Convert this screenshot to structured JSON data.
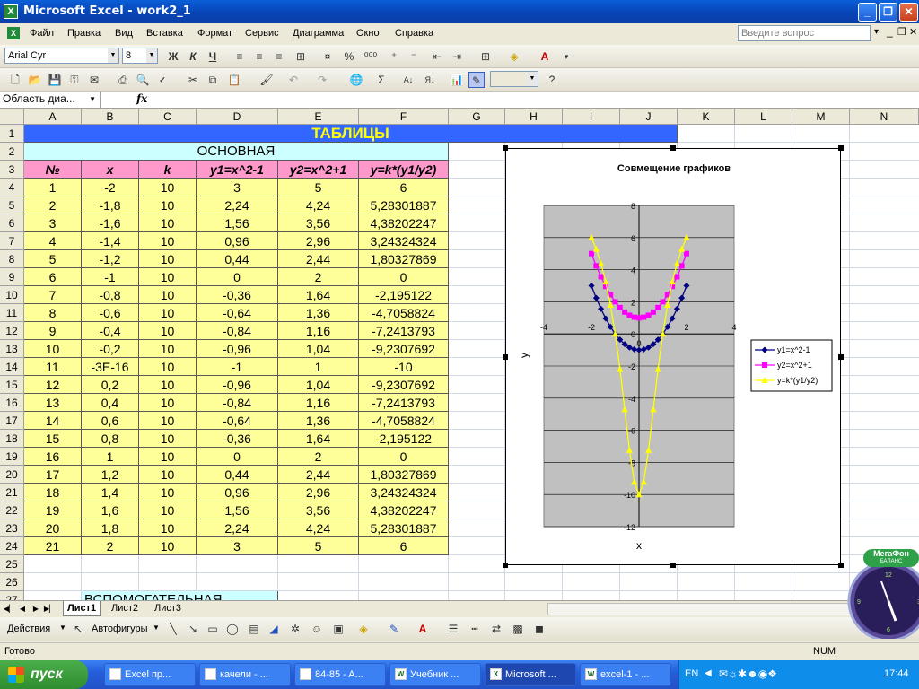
{
  "window": {
    "title": "Microsoft Excel - work2_1"
  },
  "menubar": {
    "items": [
      "Файл",
      "Правка",
      "Вид",
      "Вставка",
      "Формат",
      "Сервис",
      "Диаграмма",
      "Окно",
      "Справка"
    ],
    "ask_placeholder": "Введите вопрос"
  },
  "format_toolbar": {
    "font": "Arial Cyr",
    "size": "8",
    "bold": "Ж",
    "italic": "К",
    "underline": "Ч"
  },
  "formula_bar": {
    "name_box": "Область диа...",
    "fx": "fx"
  },
  "columns": [
    "A",
    "B",
    "C",
    "D",
    "E",
    "F",
    "G",
    "H",
    "I",
    "J",
    "K",
    "L",
    "M",
    "N"
  ],
  "rows": [
    "1",
    "2",
    "3",
    "4",
    "5",
    "6",
    "7",
    "8",
    "9",
    "10",
    "11",
    "12",
    "13",
    "14",
    "15",
    "16",
    "17",
    "18",
    "19",
    "20",
    "21",
    "22",
    "23",
    "24",
    "25",
    "26",
    "27"
  ],
  "sheet": {
    "title": "ТАБЛИЦЫ",
    "main_header": "ОСНОВНАЯ",
    "aux_header": "ВСПОМОГАТЕЛЬНАЯ",
    "headers": [
      "№",
      "x",
      "k",
      "y1=x^2-1",
      "y2=x^2+1",
      "y=k*(y1/y2)"
    ],
    "rows": [
      [
        "1",
        "-2",
        "10",
        "3",
        "5",
        "6"
      ],
      [
        "2",
        "-1,8",
        "10",
        "2,24",
        "4,24",
        "5,28301887"
      ],
      [
        "3",
        "-1,6",
        "10",
        "1,56",
        "3,56",
        "4,38202247"
      ],
      [
        "4",
        "-1,4",
        "10",
        "0,96",
        "2,96",
        "3,24324324"
      ],
      [
        "5",
        "-1,2",
        "10",
        "0,44",
        "2,44",
        "1,80327869"
      ],
      [
        "6",
        "-1",
        "10",
        "0",
        "2",
        "0"
      ],
      [
        "7",
        "-0,8",
        "10",
        "-0,36",
        "1,64",
        "-2,195122"
      ],
      [
        "8",
        "-0,6",
        "10",
        "-0,64",
        "1,36",
        "-4,7058824"
      ],
      [
        "9",
        "-0,4",
        "10",
        "-0,84",
        "1,16",
        "-7,2413793"
      ],
      [
        "10",
        "-0,2",
        "10",
        "-0,96",
        "1,04",
        "-9,2307692"
      ],
      [
        "11",
        "-3E-16",
        "10",
        "-1",
        "1",
        "-10"
      ],
      [
        "12",
        "0,2",
        "10",
        "-0,96",
        "1,04",
        "-9,2307692"
      ],
      [
        "13",
        "0,4",
        "10",
        "-0,84",
        "1,16",
        "-7,2413793"
      ],
      [
        "14",
        "0,6",
        "10",
        "-0,64",
        "1,36",
        "-4,7058824"
      ],
      [
        "15",
        "0,8",
        "10",
        "-0,36",
        "1,64",
        "-2,195122"
      ],
      [
        "16",
        "1",
        "10",
        "0",
        "2",
        "0"
      ],
      [
        "17",
        "1,2",
        "10",
        "0,44",
        "2,44",
        "1,80327869"
      ],
      [
        "18",
        "1,4",
        "10",
        "0,96",
        "2,96",
        "3,24324324"
      ],
      [
        "19",
        "1,6",
        "10",
        "1,56",
        "3,56",
        "4,38202247"
      ],
      [
        "20",
        "1,8",
        "10",
        "2,24",
        "4,24",
        "5,28301887"
      ],
      [
        "21",
        "2",
        "10",
        "3",
        "5",
        "6"
      ]
    ]
  },
  "chart_data": {
    "type": "line",
    "title": "Совмещение графиков",
    "xlabel": "x",
    "ylabel": "y",
    "xlim": [
      -4,
      4
    ],
    "ylim": [
      -12,
      8
    ],
    "x_ticks": [
      "-4",
      "-2",
      "0",
      "2",
      "4"
    ],
    "y_ticks": [
      "8",
      "6",
      "4",
      "2",
      "0",
      "-2",
      "-4",
      "-6",
      "-8",
      "-10",
      "-12"
    ],
    "grid": true,
    "legend": "right",
    "x": [
      -2,
      -1.8,
      -1.6,
      -1.4,
      -1.2,
      -1,
      -0.8,
      -0.6,
      -0.4,
      -0.2,
      0,
      0.2,
      0.4,
      0.6,
      0.8,
      1,
      1.2,
      1.4,
      1.6,
      1.8,
      2
    ],
    "series": [
      {
        "name": "y1=x^2-1",
        "color": "#000080",
        "marker": "diamond",
        "values": [
          3,
          2.24,
          1.56,
          0.96,
          0.44,
          0,
          -0.36,
          -0.64,
          -0.84,
          -0.96,
          -1,
          -0.96,
          -0.84,
          -0.64,
          -0.36,
          0,
          0.44,
          0.96,
          1.56,
          2.24,
          3
        ]
      },
      {
        "name": "y2=x^2+1",
        "color": "#FF00FF",
        "marker": "square",
        "values": [
          5,
          4.24,
          3.56,
          2.96,
          2.44,
          2,
          1.64,
          1.36,
          1.16,
          1.04,
          1,
          1.04,
          1.16,
          1.36,
          1.64,
          2,
          2.44,
          2.96,
          3.56,
          4.24,
          5
        ]
      },
      {
        "name": "y=k*(y1/y2)",
        "color": "#FFFF00",
        "marker": "triangle",
        "values": [
          6,
          5.28301887,
          4.38202247,
          3.24324324,
          1.80327869,
          0,
          -2.195122,
          -4.7058824,
          -7.2413793,
          -9.2307692,
          -10,
          -9.2307692,
          -7.2413793,
          -4.7058824,
          -2.195122,
          0,
          1.80327869,
          3.24324324,
          4.38202247,
          5.28301887,
          6
        ]
      }
    ]
  },
  "tabs": [
    "Лист1",
    "Лист2",
    "Лист3"
  ],
  "drawing_toolbar": {
    "actions": "Действия",
    "autoshapes": "Автофигуры"
  },
  "status": {
    "left": "Готово",
    "num": "NUM"
  },
  "taskbar": {
    "start": "пуск",
    "tasks": [
      "Excel пр...",
      "качели - ...",
      "84-85 - A...",
      "Учебник ...",
      "Microsoft ...",
      "excel-1 - ..."
    ],
    "lang": "EN",
    "clock": "17:44"
  },
  "gadget": {
    "brand": "МегаФон",
    "sub": "БАЛАНС"
  }
}
